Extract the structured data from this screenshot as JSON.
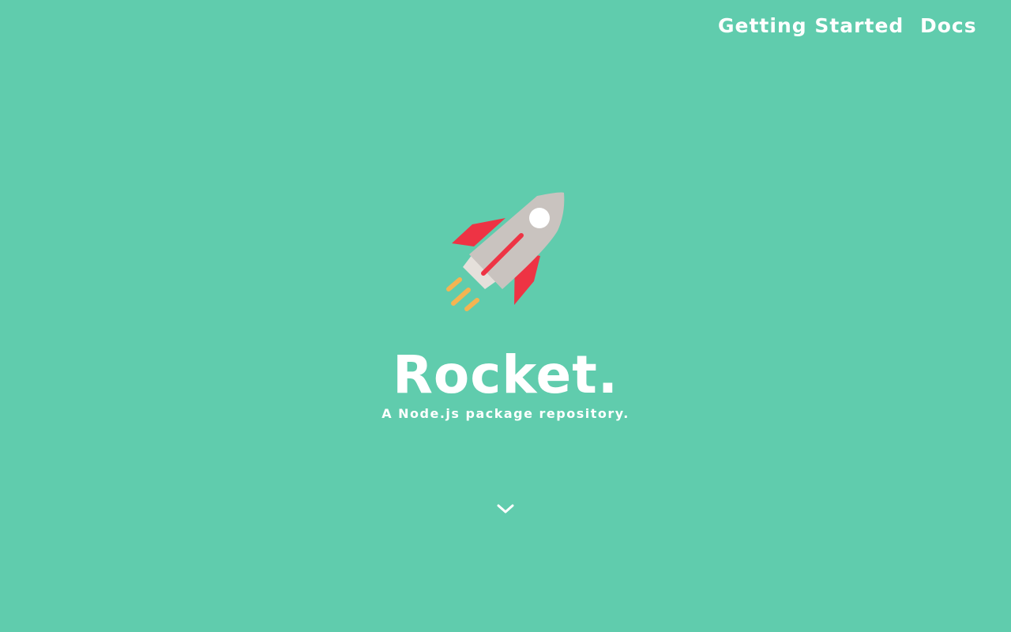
{
  "nav": {
    "items": [
      {
        "label": "Getting Started"
      },
      {
        "label": "Docs"
      }
    ]
  },
  "hero": {
    "logo_icon": "rocket-icon",
    "title": "Rocket.",
    "subtitle": "A Node.js package repository.",
    "scroll_icon": "chevron-down-icon"
  },
  "colors": {
    "background": "#60ccad",
    "text": "#ffffff",
    "rocket_body": "#c9c3bf",
    "rocket_fins": "#ee3344",
    "rocket_flames": "#f5b451"
  }
}
